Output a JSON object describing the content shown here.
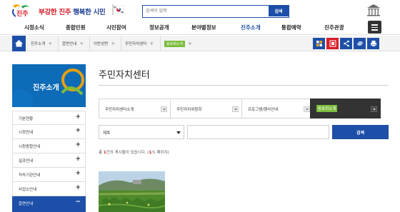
{
  "header": {
    "slogan_red": "부강한 진주",
    "slogan_blue": "행복한 시민",
    "logo_text": "진주",
    "search_placeholder": "검색어 입력",
    "search_button": "검색"
  },
  "gnb": {
    "items": [
      "시정소식",
      "종합민원",
      "시민참여",
      "정보공개",
      "분야별정보",
      "진주소개",
      "통합예약",
      "진주관광"
    ],
    "active_index": 5
  },
  "breadcrumb": {
    "items": [
      "진주소개",
      "읍면안내",
      "이반성면",
      "주민자치센터",
      "동호회소개"
    ]
  },
  "sidebar": {
    "title": "진주소개",
    "items": [
      {
        "label": "기본현황",
        "sign": "+"
      },
      {
        "label": "시정안내",
        "sign": "+"
      },
      {
        "label": "시청종합안내",
        "sign": "+"
      },
      {
        "label": "실과안내",
        "sign": "+"
      },
      {
        "label": "직속기관안내",
        "sign": "+"
      },
      {
        "label": "사업소안내",
        "sign": "+"
      },
      {
        "label": "읍면안내",
        "sign": "−"
      }
    ]
  },
  "content": {
    "title": "주민자치센터",
    "tabs": [
      "주민자치센터소개",
      "주민자치위원회",
      "프로그램/행사안내",
      "동호회소개"
    ],
    "active_tab": 3,
    "search_select": "제목",
    "search_button": "검색",
    "count_prefix": "총 ",
    "count_total": "1",
    "count_mid": "건의 게시물이 있습니다. (",
    "count_page": "1",
    "count_suffix": "/1 페이지)"
  },
  "colors": {
    "brand_blue": "#1d4fa8",
    "sidebar_blue": "#0d6bb8",
    "accent_red": "#d81e2a",
    "tag_green": "#7bbd3c"
  }
}
